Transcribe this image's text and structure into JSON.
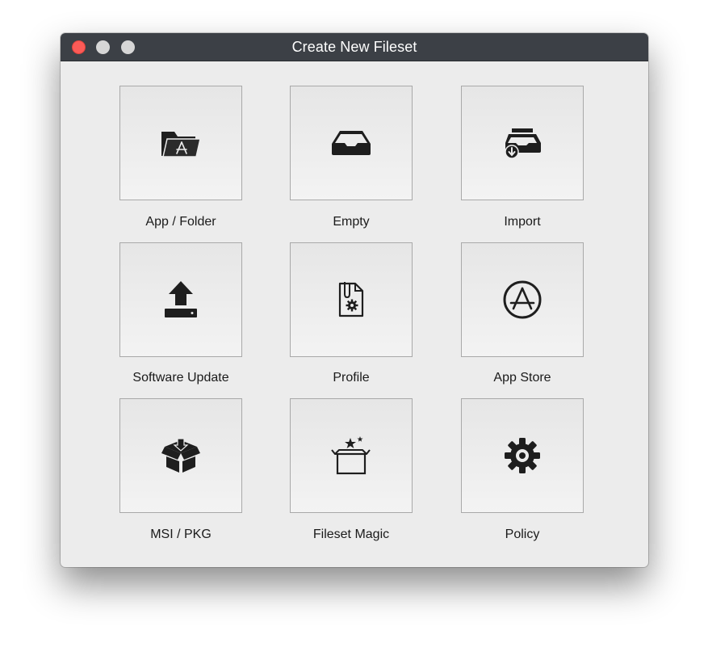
{
  "window": {
    "title": "Create New Fileset"
  },
  "tiles": [
    {
      "label": "App / Folder",
      "icon": "app-folder-icon"
    },
    {
      "label": "Empty",
      "icon": "empty-tray-icon"
    },
    {
      "label": "Import",
      "icon": "import-tray-icon"
    },
    {
      "label": "Software Update",
      "icon": "upload-arrow-icon"
    },
    {
      "label": "Profile",
      "icon": "profile-document-icon"
    },
    {
      "label": "App Store",
      "icon": "app-store-icon"
    },
    {
      "label": "MSI / PKG",
      "icon": "package-box-icon"
    },
    {
      "label": "Fileset Magic",
      "icon": "magic-box-icon"
    },
    {
      "label": "Policy",
      "icon": "gear-icon"
    }
  ],
  "colors": {
    "titlebar": "#3c4046",
    "close": "#fc5b57",
    "inactive_light": "#d6d6d6",
    "window_bg": "#ececec",
    "tile_border": "#a9a9a9",
    "icon": "#1e1e1e"
  }
}
